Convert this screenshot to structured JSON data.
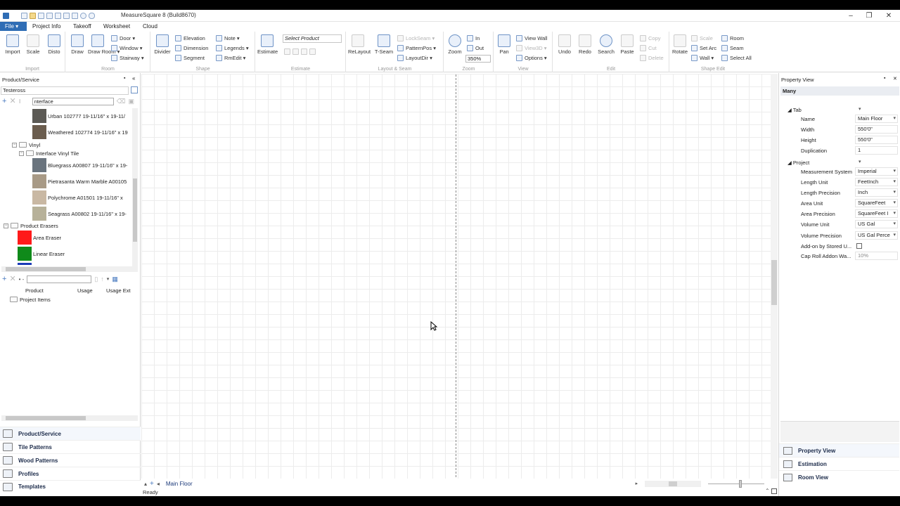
{
  "app": {
    "title": "MeasureSquare 8 (Build8670)"
  },
  "menu": {
    "file": "File ▾",
    "tabs": [
      "Project Info",
      "Takeoff",
      "Worksheet",
      "Cloud"
    ]
  },
  "ribbon": {
    "import": {
      "label": "Import",
      "buttons": [
        "Import",
        "Scale",
        "Disto"
      ]
    },
    "room": {
      "label": "Room",
      "buttons": [
        "Draw",
        "Draw Room ▾"
      ],
      "small": [
        "Door ▾",
        "Window ▾",
        "Stairway ▾"
      ]
    },
    "shape": {
      "label": "Shape",
      "big": "Divider",
      "small": [
        "Elevation",
        "Dimension",
        "Segment",
        "Note ▾",
        "Legends ▾",
        "RmEdit ▾"
      ]
    },
    "estimate": {
      "label": "Estimate",
      "big": "Estimate",
      "select_product": "Select Product"
    },
    "layout": {
      "label": "Layout & Seam",
      "buttons": [
        "ReLayout",
        "T-Seam"
      ],
      "small": [
        "LockSeam ▾",
        "PatternPos ▾",
        "LayoutDir ▾"
      ]
    },
    "zoom": {
      "label": "Zoom",
      "big": "Zoom",
      "small": [
        "In",
        "Out"
      ],
      "level": "350%"
    },
    "view": {
      "label": "View",
      "big": "Pan",
      "small": [
        "View Wall",
        "View3D ▾",
        "Options ▾"
      ]
    },
    "edit": {
      "label": "Edit",
      "buttons": [
        "Undo",
        "Redo",
        "Search",
        "Paste"
      ],
      "small": [
        "Copy",
        "Cut",
        "Delete"
      ]
    },
    "shape_edit": {
      "label": "Shape Edit",
      "big": "Rotate",
      "small": [
        "Scale",
        "Set Arc",
        "Wall ▾",
        "Room",
        "Seam",
        "Select All"
      ]
    }
  },
  "left_panel": {
    "title": "Product/Service",
    "category": "Testeross",
    "search_value": "nterface",
    "tree": [
      {
        "name": "Urban 102777 19-11/16\" x 19-11/",
        "color": "#5c5a55"
      },
      {
        "name": "Weathered 102774 19-11/16\" x 19",
        "color": "#6b5d4e"
      },
      {
        "folder": "Vinyl"
      },
      {
        "folder": "Interface Vinyl Tile"
      },
      {
        "name": "Bluegrass A00807 19-11/16\" x 19-",
        "color": "#6a747e"
      },
      {
        "name": "Pietrasanta Warm Marble A00105",
        "color": "#a89a86"
      },
      {
        "name": "Polychrome A01501 19-11/16\" x",
        "color": "#c9b8a3"
      },
      {
        "name": "Seagrass A00802 19-11/16\" x 19-",
        "color": "#b7b199"
      },
      {
        "folder": "Product Erasers"
      },
      {
        "name": "Area Eraser",
        "color": "#ff1a1a"
      },
      {
        "name": "Linear Eraser",
        "color": "#0f8a1a"
      }
    ],
    "usage_columns": [
      "Product",
      "Usage",
      "Usage Ext"
    ],
    "project_items": "Project Items",
    "nav": [
      "Product/Service",
      "Tile Patterns",
      "Wood Patterns",
      "Profiles",
      "Templates"
    ]
  },
  "canvas": {
    "tab": "Main Floor"
  },
  "status": "Ready",
  "right_panel": {
    "title": "Property View",
    "selection": "Many",
    "tab_group": "Tab",
    "tab_props": [
      {
        "label": "Name",
        "value": "Main Floor",
        "dd": true
      },
      {
        "label": "Width",
        "value": "550'0\"",
        "dd": false
      },
      {
        "label": "Height",
        "value": "550'0\"",
        "dd": false
      },
      {
        "label": "Duplication",
        "value": "1",
        "dd": false
      }
    ],
    "project_group": "Project",
    "project_props": [
      {
        "label": "Measurement System",
        "value": "Imperial",
        "dd": true
      },
      {
        "label": "Length Unit",
        "value": "FeetInch",
        "dd": true
      },
      {
        "label": "Length Precision",
        "value": "Inch",
        "dd": true
      },
      {
        "label": "Area Unit",
        "value": "SquareFeet",
        "dd": true
      },
      {
        "label": "Area Precision",
        "value": "SquareFeet I",
        "dd": true
      },
      {
        "label": "Volume Unit",
        "value": "US Gal",
        "dd": true
      },
      {
        "label": "Volume Precision",
        "value": "US Gal Perce",
        "dd": true
      },
      {
        "label": "Add-on by Stored U...",
        "value": "",
        "dd": false
      },
      {
        "label": "Cap Roll Addon Wa...",
        "value": "10%",
        "dd": false
      }
    ],
    "nav": [
      "Property View",
      "Estimation",
      "Room View"
    ]
  }
}
